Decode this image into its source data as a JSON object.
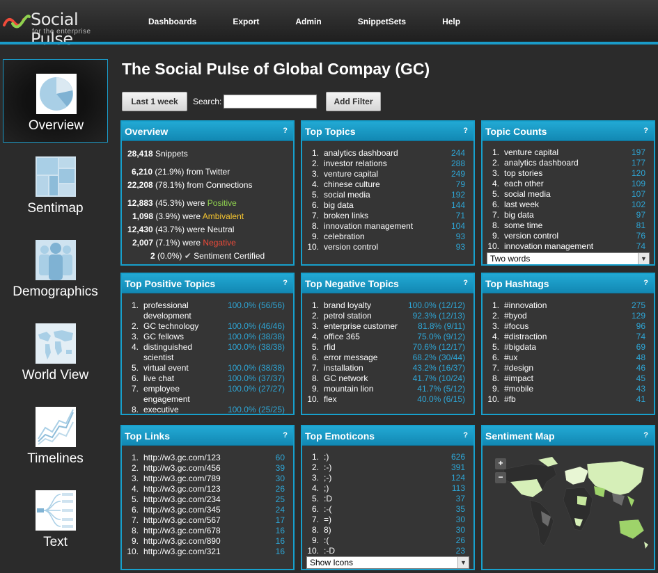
{
  "app": {
    "logo_name": "Social Pulse",
    "logo_tagline": "for the enterprise"
  },
  "nav": [
    "Dashboards",
    "Export",
    "Admin",
    "SnippetSets",
    "Help"
  ],
  "sidebar": [
    {
      "label": "Overview",
      "icon": "pie-chart-icon",
      "active": true
    },
    {
      "label": "Sentimap",
      "icon": "treemap-icon"
    },
    {
      "label": "Demographics",
      "icon": "people-icon"
    },
    {
      "label": "World View",
      "icon": "world-map-icon"
    },
    {
      "label": "Timelines",
      "icon": "line-chart-icon"
    },
    {
      "label": "Text",
      "icon": "word-tree-icon"
    }
  ],
  "page": {
    "title": "The Social Pulse of Global Compay (GC)"
  },
  "toolbar": {
    "period_label": "Last 1 week",
    "search_label": "Search:",
    "search_value": "",
    "add_filter_label": "Add Filter"
  },
  "overview": {
    "title": "Overview",
    "help": "?",
    "snippets_count": "28,418",
    "snippets_label": "Snippets",
    "twitter_count": "6,210",
    "twitter_pct": "(21.9%)",
    "twitter_label": "from Twitter",
    "connections_count": "22,208",
    "connections_pct": "(78.1%)",
    "connections_label": "from Connections",
    "positive_count": "12,883",
    "positive_pct": "(45.3%)",
    "positive_pre": "were",
    "positive_word": "Positive",
    "ambivalent_count": "1,098",
    "ambivalent_pct": "(3.9%)",
    "ambivalent_pre": "were",
    "ambivalent_word": "Ambivalent",
    "neutral_count": "12,430",
    "neutral_pct": "(43.7%)",
    "neutral_label": "were Neutral",
    "negative_count": "2,007",
    "negative_pct": "(7.1%)",
    "negative_pre": "were",
    "negative_word": "Negative",
    "certified_count": "2",
    "certified_pct": "(0.0%)",
    "certified_label": "Sentiment Certified"
  },
  "panels": {
    "top_topics": {
      "title": "Top Topics",
      "help": "?",
      "items": [
        {
          "n": "1.",
          "label": "analytics dashboard",
          "value": "244"
        },
        {
          "n": "2.",
          "label": "investor relations",
          "value": "288"
        },
        {
          "n": "3.",
          "label": "venture capital",
          "value": "249"
        },
        {
          "n": "4.",
          "label": "chinese culture",
          "value": "79"
        },
        {
          "n": "5.",
          "label": "social media",
          "value": "192"
        },
        {
          "n": "6.",
          "label": "big data",
          "value": "144"
        },
        {
          "n": "7.",
          "label": "broken links",
          "value": "71"
        },
        {
          "n": "8.",
          "label": "innovation management",
          "value": "104"
        },
        {
          "n": "9.",
          "label": "celebration",
          "value": "93"
        },
        {
          "n": "10.",
          "label": "version control",
          "value": "93"
        }
      ]
    },
    "topic_counts": {
      "title": "Topic Counts",
      "help": "?",
      "select_value": "Two words",
      "items": [
        {
          "n": "1.",
          "label": "venture capital",
          "value": "197"
        },
        {
          "n": "2.",
          "label": "analytics dashboard",
          "value": "177"
        },
        {
          "n": "3.",
          "label": "top stories",
          "value": "120"
        },
        {
          "n": "4.",
          "label": "each other",
          "value": "109"
        },
        {
          "n": "5.",
          "label": "social media",
          "value": "107"
        },
        {
          "n": "6.",
          "label": "last week",
          "value": "102"
        },
        {
          "n": "7.",
          "label": "big data",
          "value": "97"
        },
        {
          "n": "8.",
          "label": "some time",
          "value": "81"
        },
        {
          "n": "9.",
          "label": "version control",
          "value": "76"
        },
        {
          "n": "10.",
          "label": "innovation management",
          "value": "74"
        }
      ]
    },
    "top_positive": {
      "title": "Top Positive Topics",
      "help": "?",
      "items": [
        {
          "n": "1.",
          "label": "professional",
          "label2": "development",
          "value": "100.0% (56/56)"
        },
        {
          "n": "2.",
          "label": "GC technology",
          "value": "100.0% (46/46)"
        },
        {
          "n": "3.",
          "label": "GC fellows",
          "value": "100.0% (38/38)"
        },
        {
          "n": "4.",
          "label": "distinguished",
          "label2": "scientist",
          "value": "100.0% (38/38)"
        },
        {
          "n": "5.",
          "label": "virtual event",
          "value": "100.0% (38/38)"
        },
        {
          "n": "6.",
          "label": "live chat",
          "value": "100.0% (37/37)"
        },
        {
          "n": "7.",
          "label": "employee",
          "label2": "engagement",
          "value": "100.0% (27/27)"
        },
        {
          "n": "8.",
          "label": "executive",
          "value": "100.0% (25/25)"
        }
      ]
    },
    "top_negative": {
      "title": "Top Negative Topics",
      "help": "?",
      "items": [
        {
          "n": "1.",
          "label": "brand loyalty",
          "value": "100.0% (12/12)"
        },
        {
          "n": "2.",
          "label": "petrol station",
          "value": "92.3% (12/13)"
        },
        {
          "n": "3.",
          "label": "enterprise customer",
          "value": "81.8% (9/11)"
        },
        {
          "n": "4.",
          "label": "office 365",
          "value": "75.0% (9/12)"
        },
        {
          "n": "5.",
          "label": "rfid",
          "value": "70.6% (12/17)"
        },
        {
          "n": "6.",
          "label": "error message",
          "value": "68.2% (30/44)"
        },
        {
          "n": "7.",
          "label": "installation",
          "value": "43.2% (16/37)"
        },
        {
          "n": "8.",
          "label": "GC  network",
          "value": "41.7% (10/24)"
        },
        {
          "n": "9.",
          "label": "mountain lion",
          "value": "41.7% (5/12)"
        },
        {
          "n": "10.",
          "label": "flex",
          "value": "40.0% (6/15)"
        }
      ]
    },
    "top_hashtags": {
      "title": "Top Hashtags",
      "help": "?",
      "items": [
        {
          "n": "1.",
          "label": "#innovation",
          "value": "275"
        },
        {
          "n": "2.",
          "label": "#byod",
          "value": "129"
        },
        {
          "n": "3.",
          "label": "#focus",
          "value": "96"
        },
        {
          "n": "4.",
          "label": "#distraction",
          "value": "74"
        },
        {
          "n": "5.",
          "label": "#bigdata",
          "value": "69"
        },
        {
          "n": "6.",
          "label": "#ux",
          "value": "48"
        },
        {
          "n": "7.",
          "label": "#design",
          "value": "46"
        },
        {
          "n": "8.",
          "label": "#impact",
          "value": "45"
        },
        {
          "n": "9.",
          "label": "#mobile",
          "value": "43"
        },
        {
          "n": "10.",
          "label": "#fb",
          "value": "41"
        }
      ]
    },
    "top_links": {
      "title": "Top Links",
      "help": "?",
      "items": [
        {
          "n": "1.",
          "label": "http://w3.gc.com/123",
          "value": "60"
        },
        {
          "n": "2.",
          "label": "http://w3.gc.com/456",
          "value": "39"
        },
        {
          "n": "3.",
          "label": "http://w3.gc.com/789",
          "value": "30"
        },
        {
          "n": "4.",
          "label": "http://w3.gc.com/123",
          "value": "26"
        },
        {
          "n": "5.",
          "label": "http://w3.gc.com/234",
          "value": "25"
        },
        {
          "n": "6.",
          "label": "http://w3.gc.com/345",
          "value": "24"
        },
        {
          "n": "7.",
          "label": "http://w3.gc.com/567",
          "value": "17"
        },
        {
          "n": "8.",
          "label": "http://w3.gc.com/678",
          "value": "16"
        },
        {
          "n": "9.",
          "label": "http://w3.gc.com/890",
          "value": "16"
        },
        {
          "n": "10.",
          "label": "http://w3.gc.com/321",
          "value": "16"
        }
      ]
    },
    "top_emoticons": {
      "title": "Top Emoticons",
      "help": "?",
      "select_value": "Show Icons",
      "items": [
        {
          "n": "1.",
          "label": ":)",
          "value": "626"
        },
        {
          "n": "2.",
          "label": ":-)",
          "value": "391"
        },
        {
          "n": "3.",
          "label": ";-)",
          "value": "124"
        },
        {
          "n": "4.",
          "label": ";)",
          "value": "113"
        },
        {
          "n": "5.",
          "label": ":D",
          "value": "37"
        },
        {
          "n": "6.",
          "label": ":-(",
          "value": "35"
        },
        {
          "n": "7.",
          "label": "=)",
          "value": "30"
        },
        {
          "n": "8.",
          "label": "8)",
          "value": "30"
        },
        {
          "n": "9.",
          "label": ":(",
          "value": "26"
        },
        {
          "n": "10.",
          "label": ":-D",
          "value": "23"
        }
      ]
    },
    "sentiment_map": {
      "title": "Sentiment Map",
      "help": "?",
      "zoom_in": "+",
      "zoom_out": "−"
    }
  },
  "colors": {
    "accent": "#1a9bc9",
    "positive": "#8fd14f",
    "ambivalent": "#f4c430",
    "negative": "#ef4b3a",
    "count": "#2ea6d6"
  }
}
